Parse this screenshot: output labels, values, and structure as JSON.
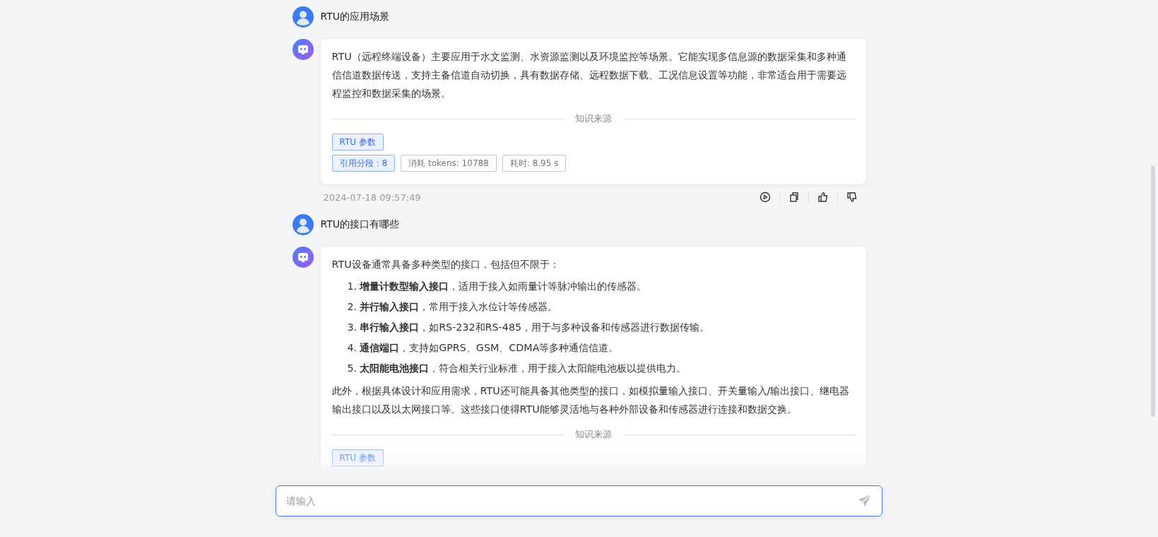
{
  "messages": [
    {
      "kind": "user",
      "text": "RTU的应用场景"
    },
    {
      "kind": "assistant",
      "blocks": [
        {
          "kind": "paragraph",
          "text": "RTU（远程终端设备）主要应用于水文监测、水资源监测以及环境监控等场景。它能实现多信息源的数据采集和多种通信信道数据传送，支持主备信道自动切换，具有数据存储、远程数据下载、工况信息设置等功能，非常适合用于需要远程监控和数据采集的场景。"
        }
      ],
      "sources_label": "知识来源",
      "source_tags": [
        "RTU 参数"
      ],
      "stats": [
        {
          "text": "引用分段：8",
          "kind": "primary"
        },
        {
          "text": "消耗 tokens: 10788",
          "kind": "plain"
        },
        {
          "text": "耗时: 8.95 s",
          "kind": "plain"
        }
      ],
      "timestamp": "2024-07-18 09:57:49"
    },
    {
      "kind": "user",
      "text": "RTU的接口有哪些"
    },
    {
      "kind": "assistant",
      "blocks": [
        {
          "kind": "paragraph",
          "text": "RTU设备通常具备多种类型的接口，包括但不限于："
        },
        {
          "kind": "list",
          "items": [
            {
              "number": "1.",
              "text": "**增量计数型输入接口**，适用于接入如雨量计等脉冲输出的传感器。"
            },
            {
              "number": "2.",
              "text": "**并行输入接口**，常用于接入水位计等传感器。"
            },
            {
              "number": "3.",
              "text": "**串行输入接口**，如RS-232和RS-485，用于与多种设备和传感器进行数据传输。"
            },
            {
              "number": "4.",
              "text": "**通信端口**，支持如GPRS、GSM、CDMA等多种通信信道。"
            },
            {
              "number": "5.",
              "text": "**太阳能电池接口**，符合相关行业标准，用于接入太阳能电池板以提供电力。"
            }
          ]
        },
        {
          "kind": "paragraph",
          "text": "此外，根据具体设计和应用需求，RTU还可能具备其他类型的接口，如模拟量输入接口、开关量输入/输出接口、继电器输出接口以及以太网接口等。这些接口使得RTU能够灵活地与各种外部设备和传感器进行连接和数据交换。"
        }
      ],
      "sources_label": "知识来源",
      "source_tags": [
        "RTU 参数"
      ]
    }
  ],
  "input": {
    "placeholder": "请输入"
  }
}
